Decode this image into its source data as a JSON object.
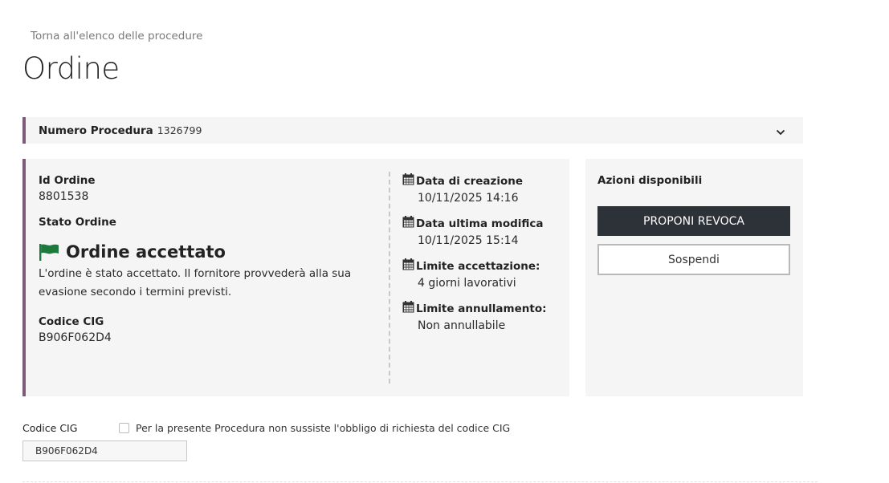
{
  "nav": {
    "back_label": "Torna all'elenco delle procedure"
  },
  "page": {
    "title": "Ordine"
  },
  "procedure": {
    "label": "Numero Procedura",
    "number": "1326799"
  },
  "order": {
    "id_label": "Id Ordine",
    "id_value": "8801538",
    "state_label": "Stato Ordine",
    "state_title": "Ordine accettato",
    "state_description": "L'ordine è stato accettato. Il fornitore provvederà alla sua evasione secondo i termini previsti.",
    "cig_label": "Codice CIG",
    "cig_value": "B906F062D4",
    "state_icon": "flag-icon",
    "state_color": "#1e7a3c"
  },
  "dates": [
    {
      "label": "Data di creazione",
      "value": "10/11/2025 14:16",
      "icon": "calendar-icon"
    },
    {
      "label": "Data ultima modifica",
      "value": "10/11/2025 15:14",
      "icon": "calendar-icon"
    },
    {
      "label": "Limite accettazione:",
      "value": "4 giorni lavorativi",
      "icon": "calendar-icon"
    },
    {
      "label": "Limite annullamento:",
      "value": "Non annullabile",
      "icon": "calendar-icon"
    }
  ],
  "actions": {
    "title": "Azioni disponibili",
    "primary_label": "PROPONI REVOCA",
    "secondary_label": "Sospendi"
  },
  "cig_form": {
    "label": "Codice CIG",
    "checkbox_label": "Per la presente Procedura non sussiste l'obbligo di richiesta del codice CIG",
    "checkbox_checked": false,
    "input_value": "B906F062D4"
  },
  "colors": {
    "accent": "#7d5c7a",
    "primary_button": "#2d3138",
    "card_background": "#f5f5f5"
  }
}
